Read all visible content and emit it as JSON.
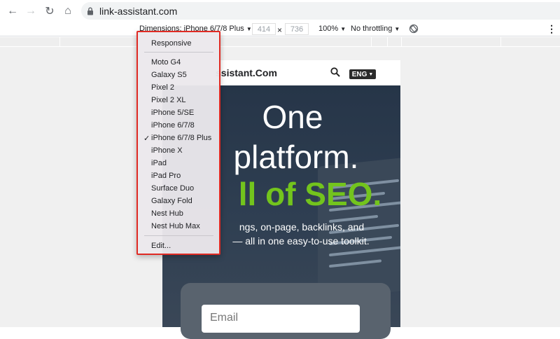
{
  "browser": {
    "url": "link-assistant.com",
    "back_glyph": "←",
    "forward_glyph": "→",
    "reload_glyph": "↻",
    "home_glyph": "⌂",
    "menu_glyph": "⋮"
  },
  "device_toolbar": {
    "dimensions_label": "Dimensions: iPhone 6/7/8 Plus",
    "width": "414",
    "times": "×",
    "height": "736",
    "zoom": "100%",
    "throttling": "No throttling",
    "caret": "▼"
  },
  "device_menu": {
    "responsive": "Responsive",
    "devices": [
      "Moto G4",
      "Galaxy S5",
      "Pixel 2",
      "Pixel 2 XL",
      "iPhone 5/SE",
      "iPhone 6/7/8",
      "iPhone 6/7/8 Plus",
      "iPhone X",
      "iPad",
      "iPad Pro",
      "Surface Duo",
      "Galaxy Fold",
      "Nest Hub",
      "Nest Hub Max"
    ],
    "selected_index": 6,
    "check_mark": "✓",
    "edit": "Edit..."
  },
  "site": {
    "logo": "ssistant.Com",
    "lang": "ENG",
    "headline_1": "One",
    "headline_2": "platform.",
    "headline_3": "ll of SEO.",
    "sub_1": "ngs, on-page, backlinks, and",
    "sub_2": "— all in one easy-to-use toolkit.",
    "email_placeholder": "Email"
  },
  "colors": {
    "accent_red": "#e02a23",
    "hero_green": "#73c41d",
    "hero_bg": "#263548"
  }
}
